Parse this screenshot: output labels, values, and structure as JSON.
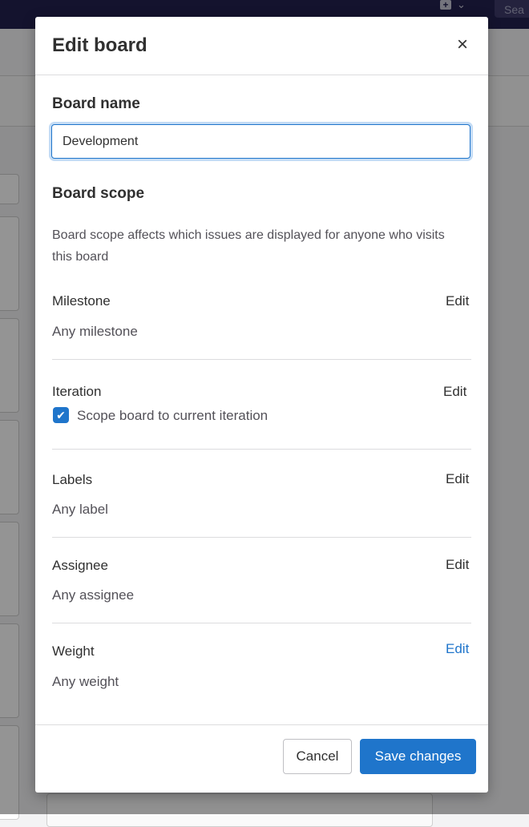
{
  "topbar": {
    "search_fragment": "Sea"
  },
  "modal": {
    "title": "Edit board",
    "close_glyph": "×",
    "board_name_label": "Board name",
    "board_name_value": "Development",
    "board_scope_label": "Board scope",
    "board_scope_description": "Board scope affects which issues are displayed for anyone who visits this board",
    "sections": {
      "milestone": {
        "title": "Milestone",
        "value": "Any milestone",
        "edit": "Edit"
      },
      "iteration": {
        "title": "Iteration",
        "checkbox_label": "Scope board to current iteration",
        "checkbox_checked": true,
        "edit": "Edit"
      },
      "labels": {
        "title": "Labels",
        "value": "Any label",
        "edit": "Edit"
      },
      "assignee": {
        "title": "Assignee",
        "value": "Any assignee",
        "edit": "Edit"
      },
      "weight": {
        "title": "Weight",
        "value": "Any weight",
        "edit": "Edit"
      }
    },
    "footer": {
      "cancel_label": "Cancel",
      "save_label": "Save changes"
    }
  },
  "colors": {
    "primary": "#1f75cb",
    "topbar": "#232150",
    "text": "#303030",
    "muted": "#535158",
    "border": "#dcdcde"
  },
  "icons": {
    "close": "close-icon",
    "checkbox": "check-icon",
    "new": "plus-square-icon",
    "dropdown": "chevron-down-icon"
  }
}
